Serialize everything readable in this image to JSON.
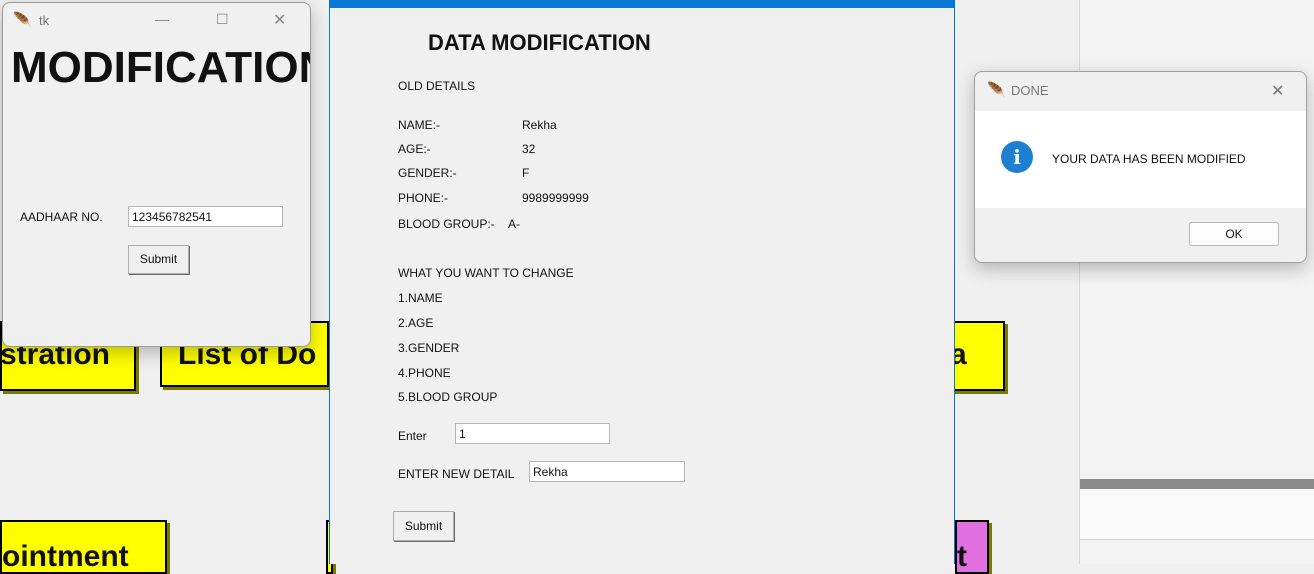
{
  "background": {
    "buttons": {
      "registration": "stration",
      "list": "List of Do",
      "data_fragment": "ta",
      "appointment": "ointment",
      "purple_fragment": "t"
    }
  },
  "tk_window": {
    "title": "tk",
    "controls": {
      "minimize": "—",
      "maximize": "☐",
      "close": "✕"
    },
    "heading": "MODIFICATION",
    "aadhaar_label": "AADHAAR NO.",
    "aadhaar_value": "123456782541",
    "submit_label": "Submit"
  },
  "modification_window": {
    "heading": "DATA MODIFICATION",
    "old_details_label": "OLD DETAILS",
    "details": [
      {
        "label": "NAME:-",
        "value": "Rekha"
      },
      {
        "label": "AGE:-",
        "value": "32"
      },
      {
        "label": "GENDER:-",
        "value": "F"
      },
      {
        "label": "PHONE:-",
        "value": "9989999999"
      },
      {
        "label": "BLOOD GROUP:-",
        "value": "A-"
      }
    ],
    "change_prompt": "WHAT YOU WANT TO CHANGE",
    "options": [
      "1.NAME",
      "2.AGE",
      "3.GENDER",
      "4.PHONE",
      "5.BLOOD GROUP"
    ],
    "enter_label": "Enter",
    "enter_value": "1",
    "new_detail_label": "ENTER NEW DETAIL",
    "new_detail_value": "Rekha",
    "submit_label": "Submit"
  },
  "dialog": {
    "title": "DONE",
    "close": "✕",
    "icon_glyph": "i",
    "message": "YOUR DATA HAS BEEN MODIFIED",
    "ok_label": "OK"
  },
  "colors": {
    "accent": "#0078d7",
    "yellow_button": "#ffff00",
    "purple_button": "#e070e0",
    "info_icon": "#1f7fd0"
  }
}
